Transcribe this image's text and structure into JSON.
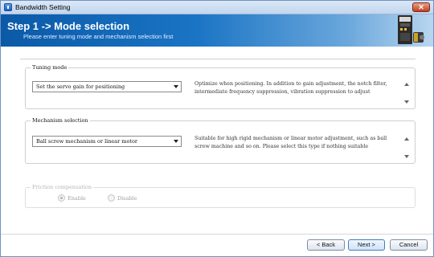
{
  "window": {
    "title": "Bandwidth Setting"
  },
  "header": {
    "title": "Step 1 -> Mode selection",
    "subtitle": "Please enter tuning mode and mechanism selection first"
  },
  "tuning_mode": {
    "label": "Tuning mode",
    "selected": "Set the servo gain for positioning",
    "description": "Optimize when positioning. In addition to gain adjustment, the notch filter, intermediate frequency suppression, vibration suppression to adjust"
  },
  "mechanism_selection": {
    "label": "Mechanism selection",
    "selected": "Ball screw mechanism or linear motor",
    "description": "Suitable for high rigid mechanism or linear motor adjustment, such as ball screw machine and so on. Please select this type if nothing suitable"
  },
  "friction_compensation": {
    "label": "Friction compensation",
    "options": [
      {
        "label": "Enable",
        "checked": true
      },
      {
        "label": "Disable",
        "checked": false
      }
    ]
  },
  "footer": {
    "back_label": "< Back",
    "next_label": "Next >",
    "cancel_label": "Cancel"
  },
  "colors": {
    "header_start": "#0b5aa8",
    "header_end": "#b9d6ef",
    "title_bar": "#c2d6ee"
  },
  "icons": {
    "app": "app-icon",
    "close": "close-icon",
    "header_image": "servo-drive-motor-image"
  }
}
